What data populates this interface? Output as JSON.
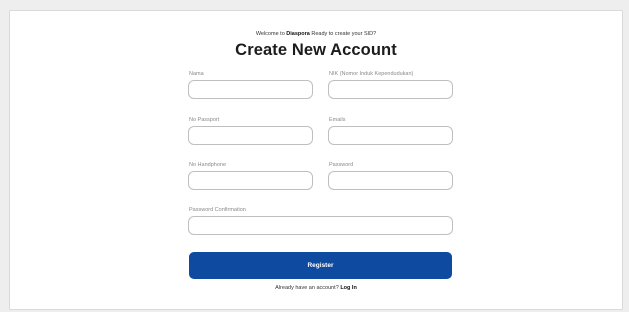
{
  "header": {
    "welcome_prefix": "Welcome to ",
    "brand": "Diaspora",
    "welcome_suffix": " Ready to create your SID?",
    "title": "Create New Account"
  },
  "form": {
    "nama_label": "Nama",
    "nik_label": "NIK (Nomor Induk Kependudukan)",
    "passport_label": "No Passport",
    "email_label": "Emails",
    "phone_label": "No Handphone",
    "password_label": "Password",
    "password_confirm_label": "Password Confirmation"
  },
  "actions": {
    "register_label": "Register",
    "login_prompt": "Already have an account? ",
    "login_link": "Log In"
  },
  "colors": {
    "primary": "#0f4aa1"
  }
}
